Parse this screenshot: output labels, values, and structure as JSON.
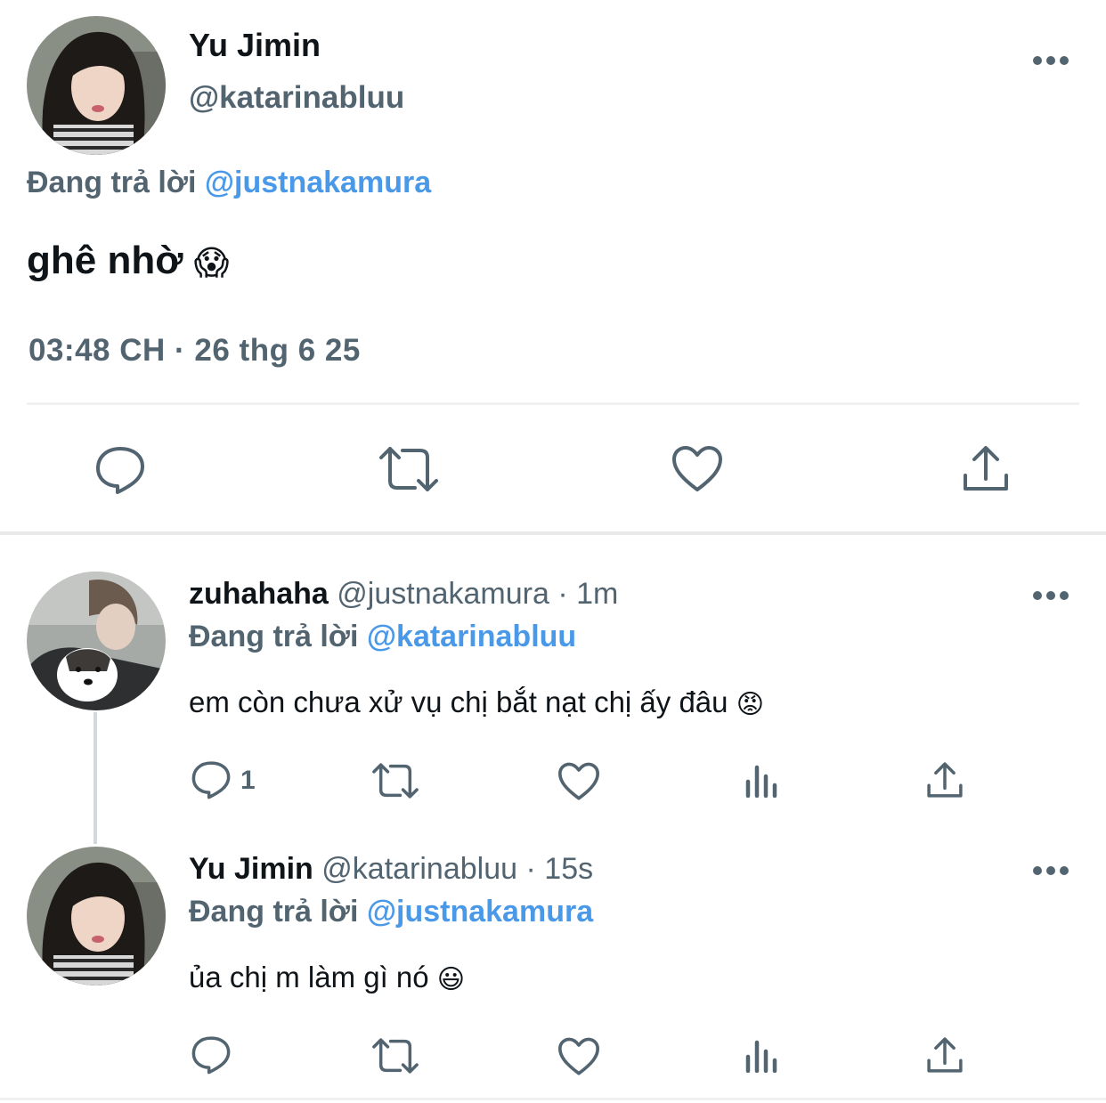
{
  "main_tweet": {
    "name": "Yu Jimin",
    "handle": "@katarinabluu",
    "replying_prefix": "Đang trả lời",
    "replying_to": "@justnakamura",
    "text": "ghê nhờ",
    "emoji": "😱",
    "timestamp": "03:48 CH · 26 thg 6 25",
    "actions": [
      "reply-icon",
      "retweet-icon",
      "like-icon",
      "share-icon"
    ]
  },
  "replies": [
    {
      "name": "zuhahaha",
      "handle": "@justnakamura",
      "sep": "·",
      "time": "1m",
      "replying_prefix": "Đang trả lời",
      "replying_to": "@katarinabluu",
      "text": "em còn chưa xử vụ chị bắt nạt chị ấy đâu",
      "emoji": "😡",
      "reply_count": "1"
    },
    {
      "name": "Yu Jimin",
      "handle": "@katarinabluu",
      "sep": "·",
      "time": "15s",
      "replying_prefix": "Đang trả lời",
      "replying_to": "@justnakamura",
      "text": "ủa chị m làm gì nó",
      "emoji": "😃",
      "reply_count": ""
    }
  ],
  "colors": {
    "text_primary": "#0f1419",
    "text_secondary": "#536471",
    "mention": "#4a99e9",
    "divider": "#eff1f3"
  }
}
